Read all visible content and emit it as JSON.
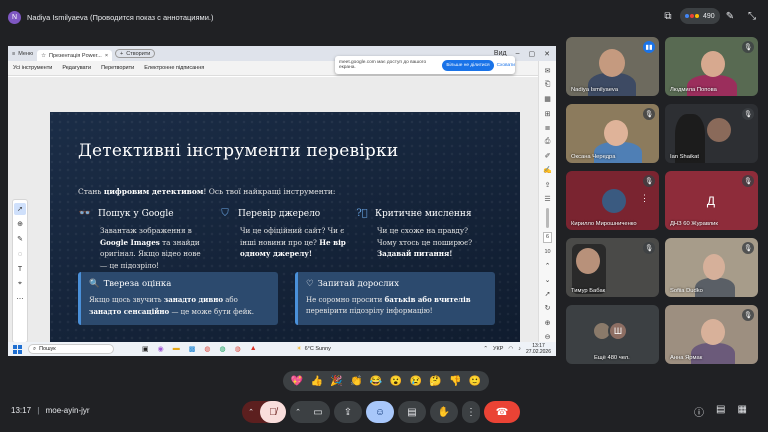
{
  "presenter": {
    "initial": "N",
    "label": "Nadiya Ismilyaeva (Проводится показ с аннотациями.)"
  },
  "top_controls": {
    "people_count": "490",
    "icons": [
      "stop-present-icon",
      "people-icon",
      "pen-icon",
      "collapse-icon"
    ]
  },
  "browser": {
    "tabs": [
      "Меню",
      "Презентація Power...",
      "Створити"
    ],
    "window_title_partial": "Вид",
    "menu": [
      "Усі інструменти",
      "Редагувати",
      "Перетворити",
      "Електронне підписання"
    ]
  },
  "share_notice": {
    "text": "meet.google.com має доступ до вашого екрана.",
    "stop_button": "Більше не ділитися",
    "hide_button": "Сховати"
  },
  "slide": {
    "title": "Детективні інструменти перевірки",
    "intro_pre": "Стань ",
    "intro_bold": "цифровим детективом",
    "intro_post": "! Ось твої найкращі інструменти:",
    "columns": [
      {
        "icon": "glasses-icon",
        "heading": "Пошук у Google",
        "p1": "Завантаж зображення в ",
        "b1": "Google Images",
        "p2": " та знайди оригінал. Якщо відео нове — це підозріло!",
        "b2": ""
      },
      {
        "icon": "shield-icon",
        "heading": "Перевір джерело",
        "p1": "Чи це офіційний сайт? Чи є інші новини про це? ",
        "b1": "Не вір одному джерелу!",
        "p2": "",
        "b2": ""
      },
      {
        "icon": "question-icon",
        "heading": "Критичне мислення",
        "p1": "Чи це схоже на правду? Чому хтось це поширює? ",
        "b1": "Задавай питання!",
        "p2": "",
        "b2": ""
      }
    ],
    "cards": [
      {
        "icon": "🔍",
        "heading": "Твереза оцінка",
        "p1": "Якщо щось звучить ",
        "b1": "занадто дивно",
        "p2": " або ",
        "b2": "занадто сенсаційно",
        "p3": " — це може бути фейк."
      },
      {
        "icon": "♡",
        "heading": "Запитай дорослих",
        "p1": "Не соромно просити ",
        "b1": "батьків або вчителів",
        "p2": " перевірити підозрілу інформацію!",
        "b2": "",
        "p3": ""
      }
    ]
  },
  "pdf_sidebar": {
    "page_number": "6",
    "total_pages": "10"
  },
  "taskbar": {
    "search_label": "Пошук",
    "weather": "6°C  Sunny",
    "language": "УКР",
    "time": "13:17",
    "date": "27.02.2026"
  },
  "participants": [
    {
      "name": "Nadiya Ismilyaeva",
      "muted": false
    },
    {
      "name": "Людмила Попова",
      "muted": true
    },
    {
      "name": "Оксана Чередра",
      "muted": true
    },
    {
      "name": "Ian Shaikat",
      "muted": true
    },
    {
      "name": "Кирилло Мирошниченко",
      "muted": true
    },
    {
      "name": "ДНЗ 60 Журавлик",
      "muted": true,
      "initial": "Д"
    },
    {
      "name": "Тимур Бабак",
      "muted": true
    },
    {
      "name": "Sofiia Dudko",
      "muted": true
    },
    {
      "name": "Ещё 480 чел.",
      "initial": "Ш"
    },
    {
      "name": "Анна Ярмак",
      "muted": true
    }
  ],
  "reactions": [
    "💖",
    "👍",
    "🎉",
    "👏",
    "😂",
    "😮",
    "😢",
    "🤔",
    "👎",
    "🙂"
  ],
  "meeting": {
    "time": "13:17",
    "code": "moe-ayin-jyr"
  },
  "colors": {
    "meet_bg": "#202124",
    "tile_bg": "#3c4043",
    "end_call": "#ea4335",
    "accent_blue": "#1a73e8",
    "slide_bg": "#152439",
    "card_bg": "#2c4a6e"
  }
}
